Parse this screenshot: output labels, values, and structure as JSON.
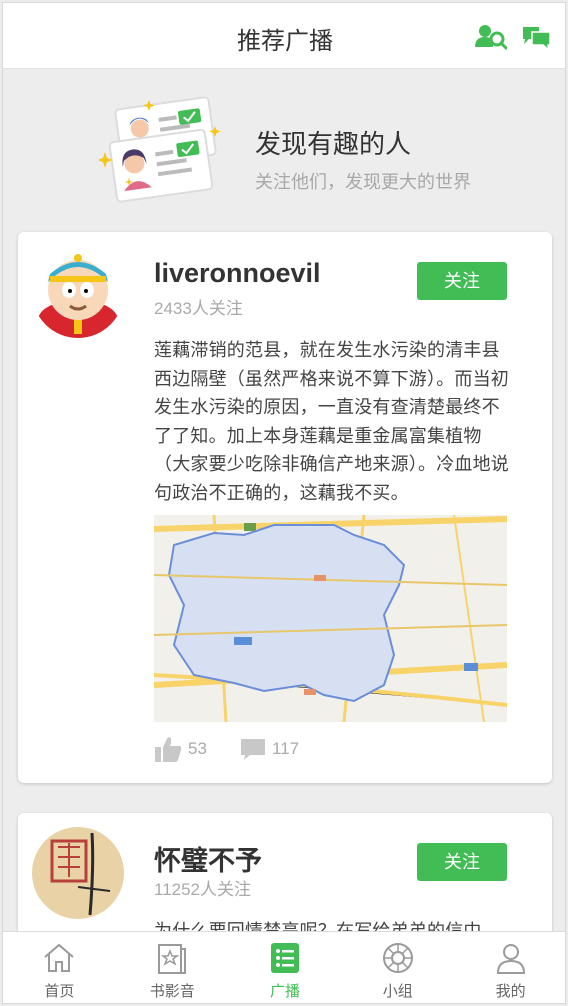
{
  "header": {
    "title": "推荐广播",
    "icons": [
      "people-search-icon",
      "chat-icon"
    ]
  },
  "promo": {
    "title": "发现有趣的人",
    "subtitle": "关注他们，发现更大的世界"
  },
  "posts": [
    {
      "username": "liveronnoevil",
      "followers": "2433人关注",
      "follow_label": "关注",
      "text": "莲藕滞销的范县，就在发生水污染的清丰县西边隔壁（虽然严格来说不算下游）。而当初发生水污染的原因，一直没有查清楚最终不了了知。加上本身莲藕是重金属富集植物（大家要少吃除非确信产地来源）。冷血地说句政治不正确的，这藕我不买。",
      "likes": "53",
      "comments": "117"
    },
    {
      "username": "怀璧不予",
      "followers": "11252人关注",
      "follow_label": "关注",
      "text": "为什么要回情禁亮呢？在写给弟弟的信中"
    }
  ],
  "tabs": [
    {
      "label": "首页",
      "icon": "home-icon"
    },
    {
      "label": "书影音",
      "icon": "media-icon"
    },
    {
      "label": "广播",
      "icon": "broadcast-icon",
      "active": true
    },
    {
      "label": "小组",
      "icon": "group-icon"
    },
    {
      "label": "我的",
      "icon": "profile-icon"
    }
  ],
  "colors": {
    "accent": "#42bd56",
    "background": "#ededed"
  }
}
